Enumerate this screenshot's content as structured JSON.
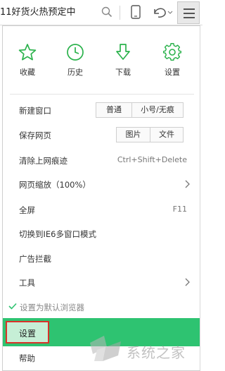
{
  "toolbar": {
    "address_text": "11好货火热预定中",
    "icons": [
      "search-icon",
      "phone-icon",
      "undo-icon",
      "menu-icon"
    ]
  },
  "quick_actions": [
    {
      "label": "收藏",
      "icon": "star-icon"
    },
    {
      "label": "历史",
      "icon": "clock-icon"
    },
    {
      "label": "下载",
      "icon": "download-icon"
    },
    {
      "label": "设置",
      "icon": "gear-icon"
    }
  ],
  "menu": {
    "new_window": {
      "label": "新建窗口",
      "buttons": [
        "普通",
        "小号/无痕"
      ]
    },
    "save_page": {
      "label": "保存网页",
      "buttons": [
        "图片",
        "文件"
      ]
    },
    "clear_history": {
      "label": "清除上网痕迹",
      "shortcut": "Ctrl+Shift+Delete"
    },
    "zoom": {
      "label": "网页缩放（100%）"
    },
    "fullscreen": {
      "label": "全屏",
      "shortcut": "F11"
    },
    "ie6_mode": {
      "label": "切换到IE6多窗口模式"
    },
    "ad_block": {
      "label": "广告拦截"
    },
    "tools": {
      "label": "工具"
    },
    "default_browser": {
      "label": "设置为默认浏览器"
    },
    "settings": {
      "label": "设置"
    },
    "help": {
      "label": "帮助"
    }
  },
  "watermark": {
    "text": "系统之家"
  },
  "colors": {
    "accent": "#2ec371",
    "highlight_border": "#d9332a",
    "icon_green": "#2bb24c"
  }
}
